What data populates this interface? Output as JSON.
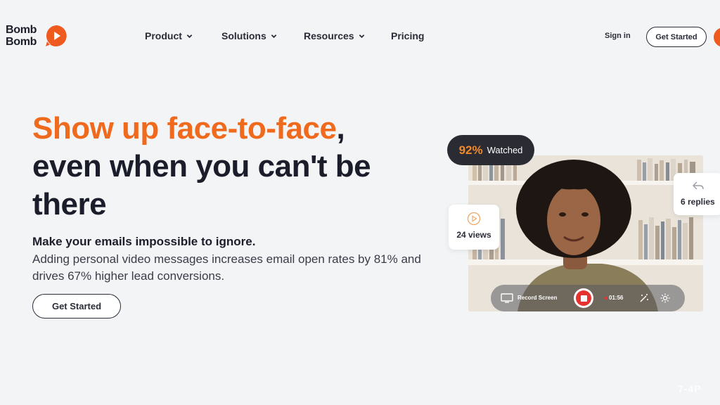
{
  "brand": {
    "logo_text": "Bomb\nBomb",
    "accent_color": "#f06a1d"
  },
  "nav": {
    "items": [
      {
        "label": "Product",
        "has_dropdown": true
      },
      {
        "label": "Solutions",
        "has_dropdown": true
      },
      {
        "label": "Resources",
        "has_dropdown": true
      },
      {
        "label": "Pricing",
        "has_dropdown": false
      }
    ],
    "sign_in": "Sign in",
    "get_started": "Get Started"
  },
  "hero": {
    "title_accent": "Show up face-to-face",
    "title_rest_1": ",",
    "title_line_2": "even when you can't be",
    "title_line_3": "there",
    "subtitle": "Make your emails impossible to ignore.",
    "description": "Adding personal video messages increases email open rates by 81% and drives 67% higher lead conversions.",
    "cta": "Get Started"
  },
  "video_card": {
    "watched_pct": "92%",
    "watched_label": "Watched",
    "views": "24 views",
    "replies": "6 replies",
    "record_label": "Record Screen",
    "timer": "01:56"
  },
  "watermark": "7-4P"
}
